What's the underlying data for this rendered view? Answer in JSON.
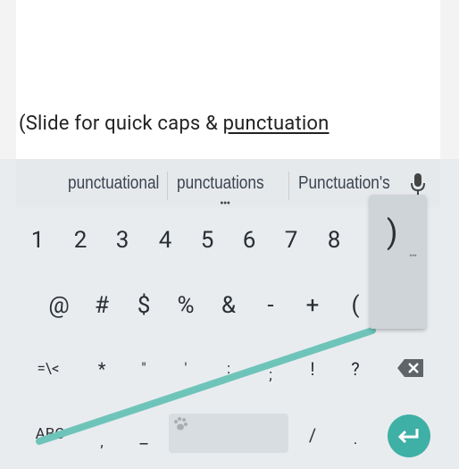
{
  "editor": {
    "text_prefix": "(Slide for quick caps & ",
    "composing_word": "punctuation"
  },
  "suggestions": [
    "punctuational",
    "punctuations",
    "Punctuation's"
  ],
  "suggestion_more": "•••",
  "keyboard": {
    "row1": [
      "1",
      "2",
      "3",
      "4",
      "5",
      "6",
      "7",
      "8"
    ],
    "row2": [
      "@",
      "#",
      "$",
      "%",
      "&",
      "-",
      "+",
      "("
    ],
    "row3_mode": "=\\<",
    "row3": [
      "*",
      "\"",
      "'",
      ":",
      ";",
      "!",
      "?"
    ],
    "row4_mode": "ABC",
    "row4": [
      ",",
      "_",
      "/",
      "."
    ],
    "popup_key": ")",
    "popup_more": "•••"
  },
  "colors": {
    "accent": "#3fb0a6",
    "trail": "#6fc4ba"
  },
  "icons": {
    "mic": "mic-icon",
    "backspace": "backspace-icon",
    "enter": "enter-icon",
    "space": "paw-icon"
  }
}
